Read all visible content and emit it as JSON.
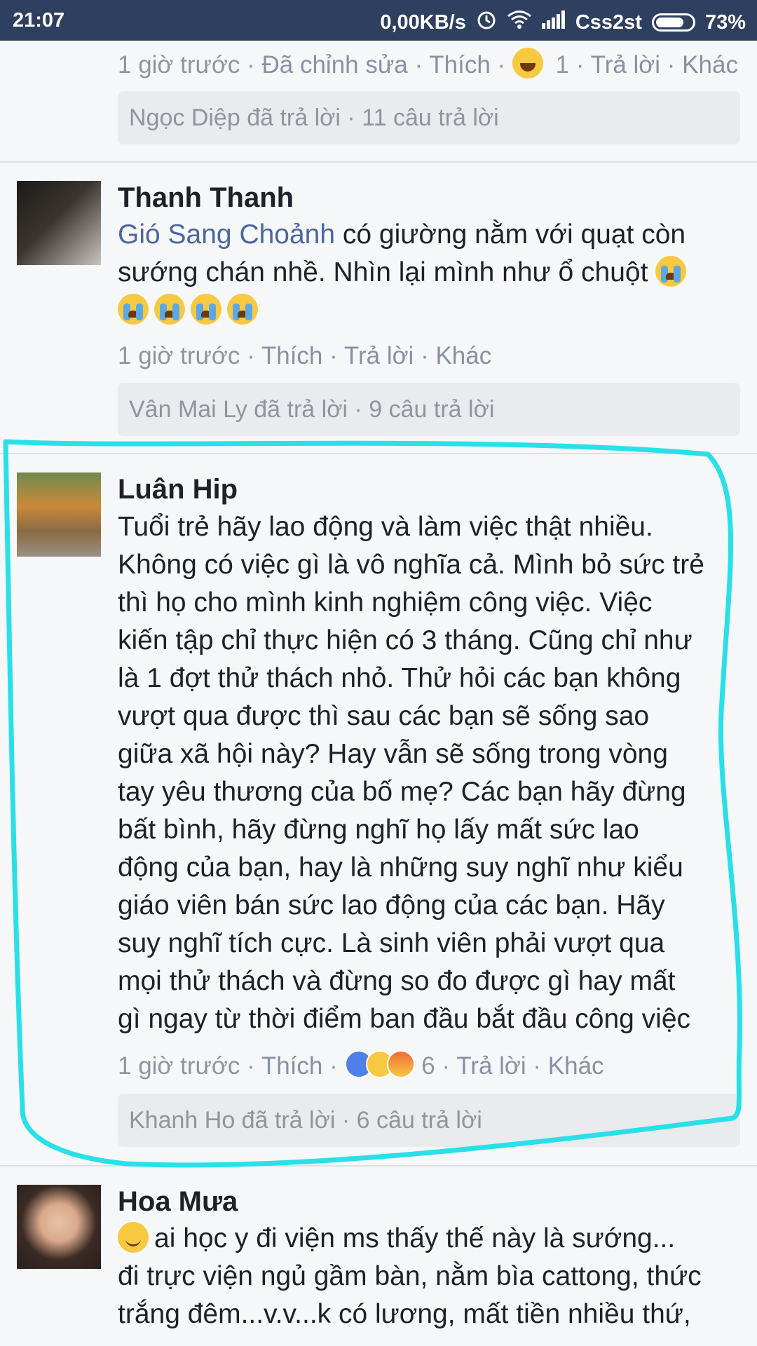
{
  "status_bar": {
    "time": "21:07",
    "network_speed": "0,00KB/s",
    "carrier": "Css2st",
    "battery": "73%",
    "icons": [
      "alarm-icon",
      "wifi-icon",
      "signal-icon",
      "battery-icon"
    ]
  },
  "comments": [
    {
      "meta": {
        "time": "1 giờ trước",
        "edited": "Đã chỉnh sửa",
        "like": "Thích",
        "reaction_count": "1",
        "reply": "Trả lời",
        "more": "Khác",
        "separator": "·"
      },
      "reply_summary": "Ngọc Diệp đã trả lời · 11 câu trả lời"
    },
    {
      "author": "Thanh Thanh",
      "mention": "Gió Sang Choảnh",
      "text": "có giường nằm với quạt còn sướng chán nhề. Nhìn lại mình như ổ chuột",
      "meta": {
        "time": "1 giờ trước",
        "like": "Thích",
        "reply": "Trả lời",
        "more": "Khác",
        "separator": "·"
      },
      "reply_summary": "Vân Mai Ly đã trả lời · 9 câu trả lời"
    },
    {
      "author": "Luân Hip",
      "lines": [
        "Tuổi trẻ hãy lao động và làm việc thật nhiều.",
        "Không có việc gì là vô nghĩa cả. Mình bỏ sức trẻ",
        "thì họ cho mình kinh nghiệm công việc. Việc",
        "kiến tập chỉ thực hiện có 3 tháng. Cũng chỉ như",
        "là 1 đợt thử thách nhỏ. Thử hỏi các bạn không",
        "vượt qua được thì sau các bạn sẽ sống sao",
        "giữa xã hội này? Hay vẫn sẽ sống trong vòng",
        "tay yêu thương của bố mẹ? Các bạn hãy đừng",
        "bất bình, hãy đừng nghĩ họ lấy mất sức lao",
        "động của bạn, hay là những suy nghĩ như kiểu",
        "giáo viên bán sức lao động của các bạn. Hãy",
        "suy nghĩ tích cực. Là sinh viên phải vượt qua",
        "mọi thử thách và đừng so đo được gì hay mất",
        "gì ngay từ thời điểm ban đầu bắt đầu công việc"
      ],
      "meta": {
        "time": "1 giờ trước",
        "like": "Thích",
        "reaction_count": "6",
        "reply": "Trả lời",
        "more": "Khác",
        "separator": "·"
      },
      "reply_summary": "Khanh Ho đã trả lời · 6 câu trả lời"
    },
    {
      "author": "Hoa Mưa",
      "lines": [
        "ai học y đi viện ms thấy thế này là sướng...",
        "đi trực viện ngủ gầm bàn, nằm bìa cattong, thức",
        "trắng đêm...v.v...k có lương, mất tiền nhiều thứ,"
      ]
    }
  ],
  "colors": {
    "status_bar": "#2f3f5f",
    "mention": "#4b67a1",
    "meta": "#90949c",
    "highlight": "#29e0e8"
  }
}
